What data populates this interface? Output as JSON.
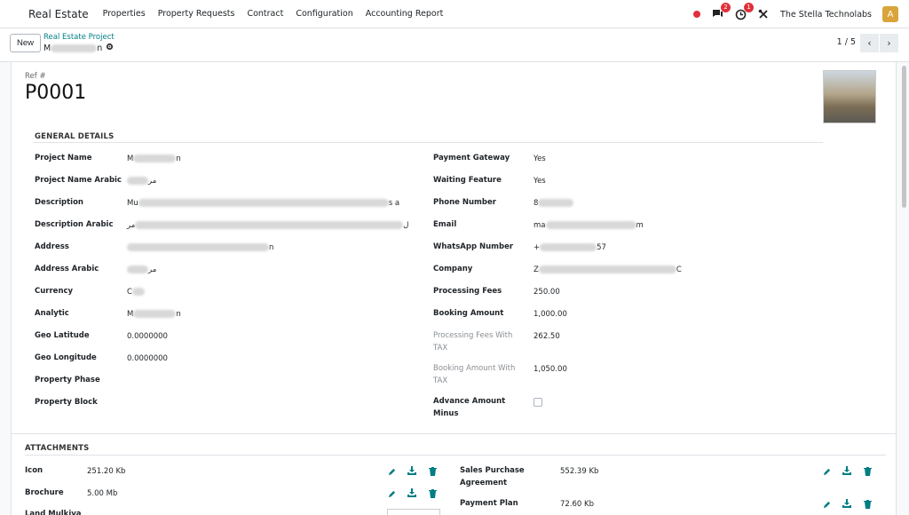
{
  "topnav": {
    "app_name": "Real Estate",
    "menu": [
      "Properties",
      "Property Requests",
      "Contract",
      "Configuration",
      "Accounting Report"
    ],
    "messages_count": "2",
    "activities_count": "1",
    "company": "The Stella Technolabs",
    "avatar_letter": "A"
  },
  "control_panel": {
    "new_label": "New",
    "breadcrumb_parent": "Real Estate Project",
    "breadcrumb_current_start": "M",
    "breadcrumb_current_end": "n",
    "pager": "1 / 5"
  },
  "record": {
    "ref_label": "Ref #",
    "ref_value": "P0001"
  },
  "general": {
    "title": "GENERAL DETAILS",
    "left": [
      {
        "label": "Project Name",
        "value_start": "M",
        "value_end": "n"
      },
      {
        "label": "Project Name Arabic",
        "value_start": "",
        "value_end": "مر"
      },
      {
        "label": "Description",
        "value_start": "Mu",
        "value_end": "s a"
      },
      {
        "label": "Description Arabic",
        "value_start": "ل",
        "value_end": "مر"
      },
      {
        "label": "Address",
        "value_start": "",
        "value_end": "n"
      },
      {
        "label": "Address Arabic",
        "value_start": "",
        "value_end": "مر"
      },
      {
        "label": "Currency",
        "value_start": "C",
        "value_end": ""
      },
      {
        "label": "Analytic",
        "value_start": "M",
        "value_end": "n"
      },
      {
        "label": "Geo Latitude",
        "value_start": "0.0000000",
        "value_end": ""
      },
      {
        "label": "Geo Longitude",
        "value_start": "0.0000000",
        "value_end": ""
      },
      {
        "label": "Property Phase",
        "value_start": "",
        "value_end": ""
      },
      {
        "label": "Property Block",
        "value_start": "",
        "value_end": ""
      }
    ],
    "right": [
      {
        "label": "Payment Gateway",
        "value_start": "Yes",
        "value_end": ""
      },
      {
        "label": "Waiting Feature",
        "value_start": "Yes",
        "value_end": ""
      },
      {
        "label": "Phone Number",
        "value_start": "8",
        "value_end": ""
      },
      {
        "label": "Email",
        "value_start": "ma",
        "value_end": "m"
      },
      {
        "label": "WhatsApp Number",
        "value_start": "+",
        "value_end": "57"
      },
      {
        "label": "Company",
        "value_start": "Z",
        "value_end": "C"
      },
      {
        "label": "Processing Fees",
        "value_start": "250.00",
        "value_end": ""
      },
      {
        "label": "Booking Amount",
        "value_start": "1,000.00",
        "value_end": ""
      },
      {
        "label_line1": "Processing Fees With",
        "label_line2": "TAX",
        "value_start": "262.50",
        "value_end": ""
      },
      {
        "label_line1": "Booking Amount With",
        "label_line2": "TAX",
        "value_start": "1,050.00",
        "value_end": ""
      },
      {
        "label_line1": "Advance Amount",
        "label_line2": "Minus",
        "checked": false
      }
    ]
  },
  "attachments": {
    "title": "ATTACHMENTS",
    "left": [
      {
        "label": "Icon",
        "size": "251.20 Kb"
      },
      {
        "label": "Brochure",
        "size": "5.00 Mb"
      },
      {
        "label": "Land Mulkiya",
        "size": ""
      }
    ],
    "right": [
      {
        "label_line1": "Sales Purchase",
        "label_line2": "Agreement",
        "size": "552.39 Kb"
      },
      {
        "label": "Payment Plan",
        "size": "72.60 Kb"
      }
    ]
  },
  "colors": {
    "accent": "#017e84",
    "badge": "#e0303a",
    "avatar": "#d9a43c"
  }
}
